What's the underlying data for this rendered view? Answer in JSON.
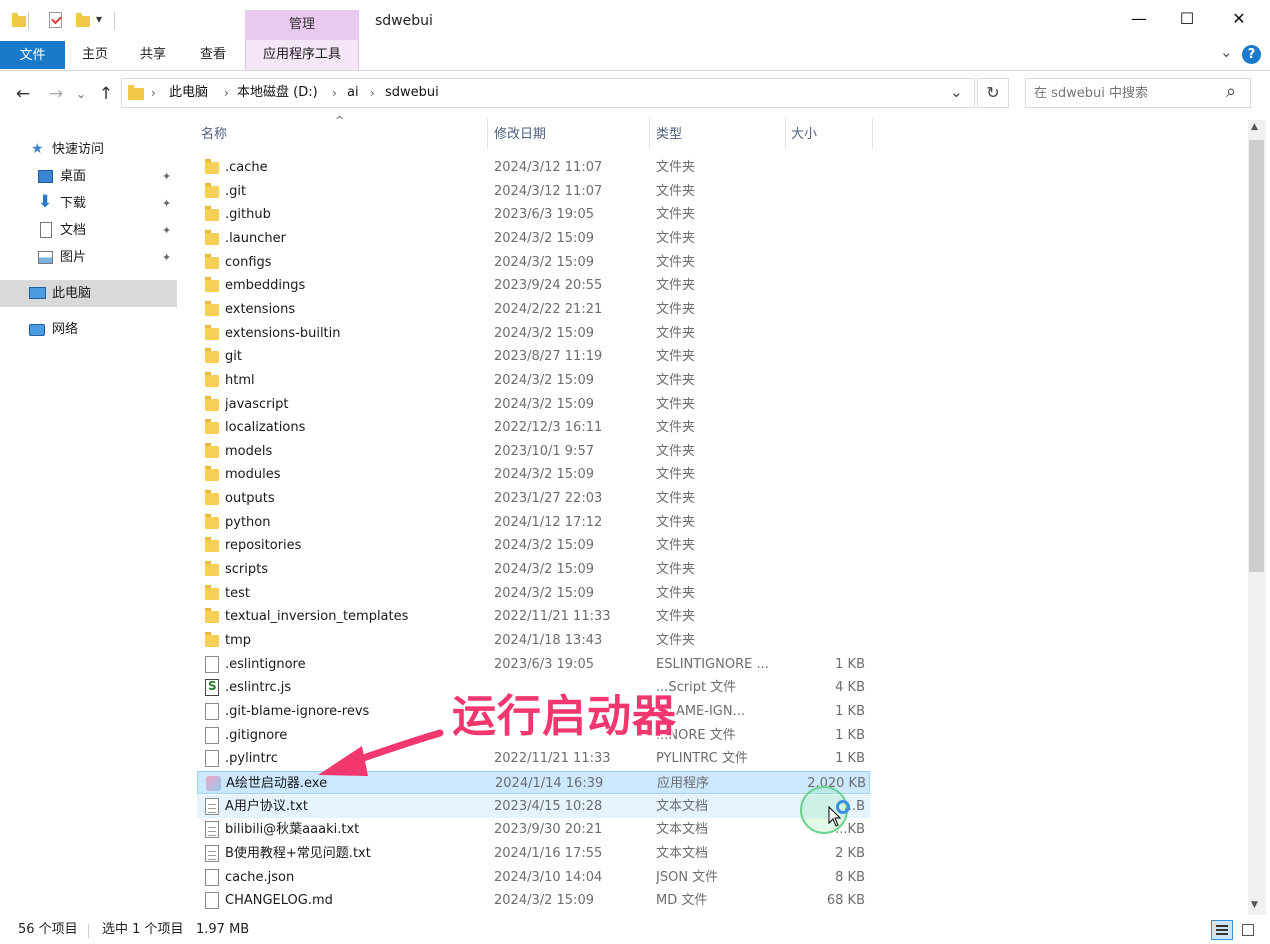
{
  "window": {
    "title": "sdwebui",
    "qa_dropdown": "▾",
    "minimize": "—",
    "maximize": "☐",
    "close": "✕"
  },
  "ribbon": {
    "file_tab": "文件",
    "home_tab": "主页",
    "share_tab": "共享",
    "view_tab": "查看",
    "manage_context": "管理",
    "app_tools_tab": "应用程序工具",
    "expand_icon": "⌄",
    "help_icon": "?"
  },
  "nav": {
    "back": "←",
    "forward": "→",
    "recent": "⌄",
    "up": "↑",
    "refresh": "↻",
    "address_dropdown": "⌄"
  },
  "breadcrumb": [
    "此电脑",
    "本地磁盘 (D:)",
    "ai",
    "sdwebui"
  ],
  "breadcrumb_sep": "›",
  "search": {
    "placeholder": "在 sdwebui 中搜索",
    "icon": "⌕"
  },
  "sidebar": {
    "quick_access": "快速访问",
    "pin": "📌",
    "items": [
      {
        "label": "桌面"
      },
      {
        "label": "下载"
      },
      {
        "label": "文档"
      },
      {
        "label": "图片"
      }
    ],
    "this_pc": "此电脑",
    "network": "网络"
  },
  "columns": {
    "name": "名称",
    "date": "修改日期",
    "type": "类型",
    "size": "大小",
    "sort_arrow": "^"
  },
  "rows": [
    {
      "name": ".cache",
      "date": "2024/3/12 11:07",
      "type": "文件夹",
      "size": "",
      "icon": "folder"
    },
    {
      "name": ".git",
      "date": "2024/3/12 11:07",
      "type": "文件夹",
      "size": "",
      "icon": "folder"
    },
    {
      "name": ".github",
      "date": "2023/6/3 19:05",
      "type": "文件夹",
      "size": "",
      "icon": "folder"
    },
    {
      "name": ".launcher",
      "date": "2024/3/2 15:09",
      "type": "文件夹",
      "size": "",
      "icon": "folder"
    },
    {
      "name": "configs",
      "date": "2024/3/2 15:09",
      "type": "文件夹",
      "size": "",
      "icon": "folder"
    },
    {
      "name": "embeddings",
      "date": "2023/9/24 20:55",
      "type": "文件夹",
      "size": "",
      "icon": "folder"
    },
    {
      "name": "extensions",
      "date": "2024/2/22 21:21",
      "type": "文件夹",
      "size": "",
      "icon": "folder"
    },
    {
      "name": "extensions-builtin",
      "date": "2024/3/2 15:09",
      "type": "文件夹",
      "size": "",
      "icon": "folder"
    },
    {
      "name": "git",
      "date": "2023/8/27 11:19",
      "type": "文件夹",
      "size": "",
      "icon": "folder"
    },
    {
      "name": "html",
      "date": "2024/3/2 15:09",
      "type": "文件夹",
      "size": "",
      "icon": "folder"
    },
    {
      "name": "javascript",
      "date": "2024/3/2 15:09",
      "type": "文件夹",
      "size": "",
      "icon": "folder"
    },
    {
      "name": "localizations",
      "date": "2022/12/3 16:11",
      "type": "文件夹",
      "size": "",
      "icon": "folder"
    },
    {
      "name": "models",
      "date": "2023/10/1 9:57",
      "type": "文件夹",
      "size": "",
      "icon": "folder"
    },
    {
      "name": "modules",
      "date": "2024/3/2 15:09",
      "type": "文件夹",
      "size": "",
      "icon": "folder"
    },
    {
      "name": "outputs",
      "date": "2023/1/27 22:03",
      "type": "文件夹",
      "size": "",
      "icon": "folder"
    },
    {
      "name": "python",
      "date": "2024/1/12 17:12",
      "type": "文件夹",
      "size": "",
      "icon": "folder"
    },
    {
      "name": "repositories",
      "date": "2024/3/2 15:09",
      "type": "文件夹",
      "size": "",
      "icon": "folder"
    },
    {
      "name": "scripts",
      "date": "2024/3/2 15:09",
      "type": "文件夹",
      "size": "",
      "icon": "folder"
    },
    {
      "name": "test",
      "date": "2024/3/2 15:09",
      "type": "文件夹",
      "size": "",
      "icon": "folder"
    },
    {
      "name": "textual_inversion_templates",
      "date": "2022/11/21 11:33",
      "type": "文件夹",
      "size": "",
      "icon": "folder"
    },
    {
      "name": "tmp",
      "date": "2024/1/18 13:43",
      "type": "文件夹",
      "size": "",
      "icon": "folder"
    },
    {
      "name": ".eslintignore",
      "date": "2023/6/3 19:05",
      "type": "ESLINTIGNORE ...",
      "size": "1 KB",
      "icon": "file"
    },
    {
      "name": ".eslintrc.js",
      "date": "",
      "type": "...Script 文件",
      "size": "4 KB",
      "icon": "js"
    },
    {
      "name": ".git-blame-ignore-revs",
      "date": "",
      "type": "...LAME-IGN...",
      "size": "1 KB",
      "icon": "file"
    },
    {
      "name": ".gitignore",
      "date": "",
      "type": "...NORE 文件",
      "size": "1 KB",
      "icon": "file"
    },
    {
      "name": ".pylintrc",
      "date": "2022/11/21 11:33",
      "type": "PYLINTRC 文件",
      "size": "1 KB",
      "icon": "file"
    },
    {
      "name": "A绘世启动器.exe",
      "date": "2024/1/14 16:39",
      "type": "应用程序",
      "size": "2,020 KB",
      "icon": "exe",
      "state": "selected"
    },
    {
      "name": "A用户协议.txt",
      "date": "2023/4/15 10:28",
      "type": "文本文档",
      "size": "...B",
      "icon": "txt",
      "state": "hover"
    },
    {
      "name": "bilibili@秋葉aaaki.txt",
      "date": "2023/9/30 20:21",
      "type": "文本文档",
      "size": "...KB",
      "icon": "txt"
    },
    {
      "name": "B使用教程+常见问题.txt",
      "date": "2024/1/16 17:55",
      "type": "文本文档",
      "size": "2 KB",
      "icon": "txt"
    },
    {
      "name": "cache.json",
      "date": "2024/3/10 14:04",
      "type": "JSON 文件",
      "size": "8 KB",
      "icon": "file"
    },
    {
      "name": "CHANGELOG.md",
      "date": "2024/3/2 15:09",
      "type": "MD 文件",
      "size": "68 KB",
      "icon": "file"
    }
  ],
  "status": {
    "count": "56 个项目",
    "selected": "选中 1 个项目",
    "size": "1.97 MB"
  },
  "annotation": {
    "text": "运行启动器"
  },
  "scroll": {
    "up": "▲",
    "down": "▼"
  }
}
